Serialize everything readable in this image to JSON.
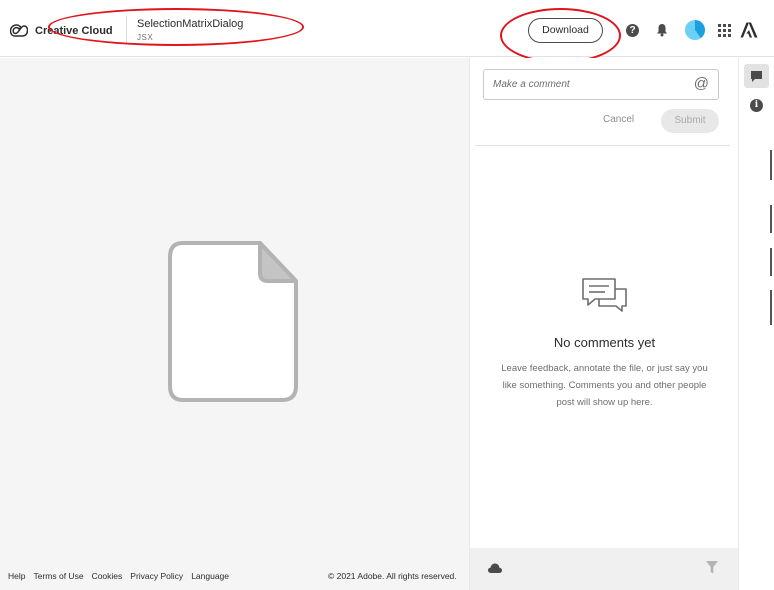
{
  "header": {
    "brand": "Creative Cloud",
    "file_title": "SelectionMatrixDialog",
    "file_type": "JSX",
    "download_label": "Download",
    "help_icon": "help-icon",
    "help_glyph": "?",
    "notification_icon": "bell-icon",
    "apps_icon": "apps-grid-icon",
    "adobe_icon": "adobe-logo-icon"
  },
  "preview": {
    "icon": "generic-file-icon"
  },
  "footer": {
    "links": [
      "Help",
      "Terms of Use",
      "Cookies",
      "Privacy Policy",
      "Language"
    ],
    "copyright": "© 2021 Adobe. All rights reserved."
  },
  "comments": {
    "placeholder": "Make a comment",
    "mention_glyph": "@",
    "cancel_label": "Cancel",
    "submit_label": "Submit",
    "empty_title": "No comments yet",
    "empty_text": "Leave feedback, annotate the file, or just say you like something. Comments you and other people post will show up here."
  },
  "rail": {
    "info_glyph": "i"
  },
  "colors": {
    "annotation": "#e0141b",
    "panel_bg": "#f5f5f5",
    "text": "#2c2c2c",
    "muted": "#6e6e6e",
    "avatar": "#1aa0e0"
  }
}
